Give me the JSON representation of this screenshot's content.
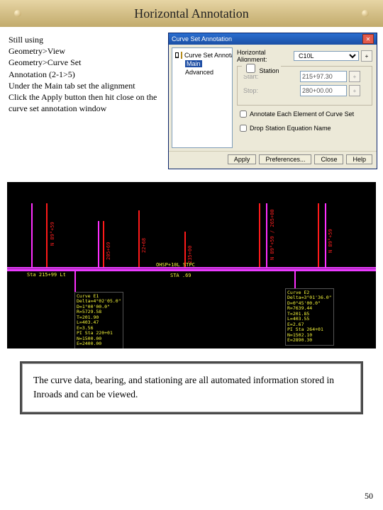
{
  "title": "Horizontal Annotation",
  "page_number": "50",
  "instructions": {
    "l1": "Still using",
    "l2": "Geometry>View",
    "l3": "Geometry>Curve Set",
    "l4": "Annotation (2-1>5)",
    "l5": "Under the Main tab set the alignment",
    "l6": "Click the Apply button then hit close on the curve set annotation window"
  },
  "dialog": {
    "title": "Curve Set Annotation",
    "tree_root": "Curve Set Annotation",
    "tree_tab": "Main",
    "tree_tab2": "Advanced",
    "labels": {
      "alignment": "Horizontal Alignment:",
      "station": "Station",
      "start": "Start:",
      "stop": "Stop:"
    },
    "values": {
      "alignment_value": "C10L",
      "start_val": "215+97.30",
      "stop_val": "280+00.00"
    },
    "checks": {
      "omit": "Drop Station Equation Name",
      "annotate": "Annotate Each Element of Curve Set"
    },
    "buttons": {
      "apply": "Apply",
      "prefs": "Preferences...",
      "close": "Close",
      "help": "Help"
    }
  },
  "cad": {
    "tick_labels": [
      "N 89°+59",
      "205+69",
      "22+68",
      "235+00",
      "N 89°+59 / 265+00",
      "N 89°+59"
    ],
    "sta_positions": [
      55,
      135,
      185,
      250,
      355,
      438
    ],
    "yellow_top1": "Sta 215+99 Lt",
    "yellow_top2": "OHSP+10L STPC",
    "yellow_top3": "STA .69",
    "curve1": "Curve E1\nDelta=4°02'05.0\"\nD=1°00'00.0\"\nR=5729.58\nT=201.90\nL=403.47\nE=3.56\nPI Sta 220+01\nN=1500.00\nE=2400.00",
    "curve2": "Curve E2\nDelta=3°01'36.0\"\nD=0°45'00.0\"\nR=7639.44\nT=201.85\nL=403.55\nE=2.67\nPI Sta 264+01\nN=1502.10\nE=2890.30"
  },
  "caption": "The curve data, bearing, and stationing are all automated information stored in Inroads and can be viewed."
}
